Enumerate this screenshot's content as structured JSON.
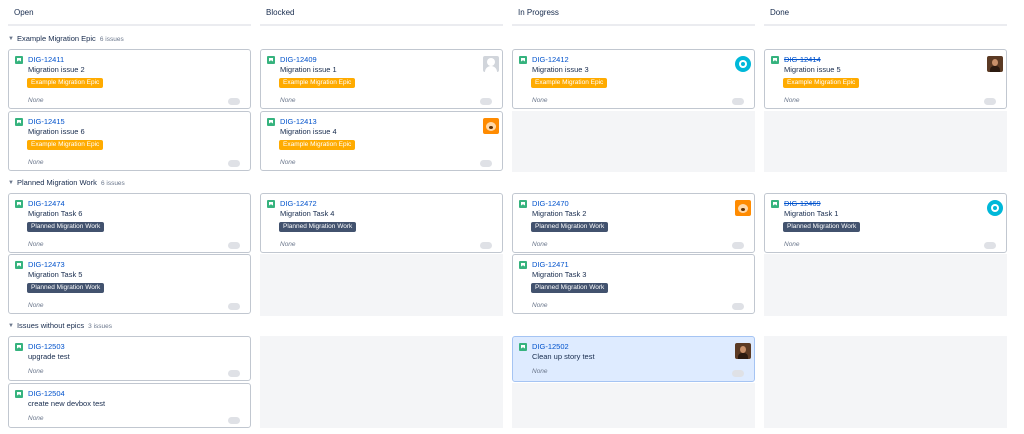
{
  "columns": [
    "Open",
    "Blocked",
    "In Progress",
    "Done"
  ],
  "swimlanes": [
    {
      "title": "Example Migration Epic",
      "count": "6 issues"
    },
    {
      "title": "Planned Migration Work",
      "count": "6 issues"
    },
    {
      "title": "Issues without epics",
      "count": "3 issues"
    }
  ],
  "cards": {
    "c12411": {
      "key": "DIG-12411",
      "summary": "Migration issue 2",
      "epic": "Example Migration Epic",
      "estimate": "None"
    },
    "c12409": {
      "key": "DIG-12409",
      "summary": "Migration issue 1",
      "epic": "Example Migration Epic",
      "estimate": "None",
      "avatar": "default-avatar-icon"
    },
    "c12412": {
      "key": "DIG-12412",
      "summary": "Migration issue 3",
      "epic": "Example Migration Epic",
      "estimate": "None",
      "avatar": "teal-avatar-icon"
    },
    "c12414": {
      "key": "DIG-12414",
      "summary": "Migration issue 5",
      "epic": "Example Migration Epic",
      "estimate": "None",
      "avatar": "photo-avatar",
      "done": true
    },
    "c12415": {
      "key": "DIG-12415",
      "summary": "Migration issue 6",
      "epic": "Example Migration Epic",
      "estimate": "None"
    },
    "c12413": {
      "key": "DIG-12413",
      "summary": "Migration issue 4",
      "epic": "Example Migration Epic",
      "estimate": "None",
      "avatar": "fox-avatar-icon"
    },
    "c12474": {
      "key": "DIG-12474",
      "summary": "Migration Task 6",
      "epic": "Planned Migration Work",
      "estimate": "None"
    },
    "c12472": {
      "key": "DIG-12472",
      "summary": "Migration Task 4",
      "epic": "Planned Migration Work",
      "estimate": "None"
    },
    "c12470": {
      "key": "DIG-12470",
      "summary": "Migration Task 2",
      "epic": "Planned Migration Work",
      "estimate": "None",
      "avatar": "fox-avatar-icon"
    },
    "c12469": {
      "key": "DIG-12469",
      "summary": "Migration Task 1",
      "epic": "Planned Migration Work",
      "estimate": "None",
      "avatar": "teal-avatar-icon",
      "done": true
    },
    "c12473": {
      "key": "DIG-12473",
      "summary": "Migration Task 5",
      "epic": "Planned Migration Work",
      "estimate": "None"
    },
    "c12471": {
      "key": "DIG-12471",
      "summary": "Migration Task 3",
      "epic": "Planned Migration Work",
      "estimate": "None"
    },
    "c12503": {
      "key": "DIG-12503",
      "summary": "upgrade test",
      "estimate": "None"
    },
    "c12502": {
      "key": "DIG-12502",
      "summary": "Clean up story test",
      "estimate": "None",
      "avatar": "photo-avatar",
      "selected": true
    },
    "c12504": {
      "key": "DIG-12504",
      "summary": "create new devbox test",
      "estimate": "None"
    }
  },
  "icons": {
    "story_type": "story-icon",
    "collapse": "chevron-down-icon",
    "estimate_toggle": "toggle-icon"
  },
  "colors": {
    "story": "#36b37e",
    "epic_orange": "#ffab00",
    "epic_slate": "#42526e",
    "link": "#0052cc",
    "selected_card": "#deebff"
  }
}
